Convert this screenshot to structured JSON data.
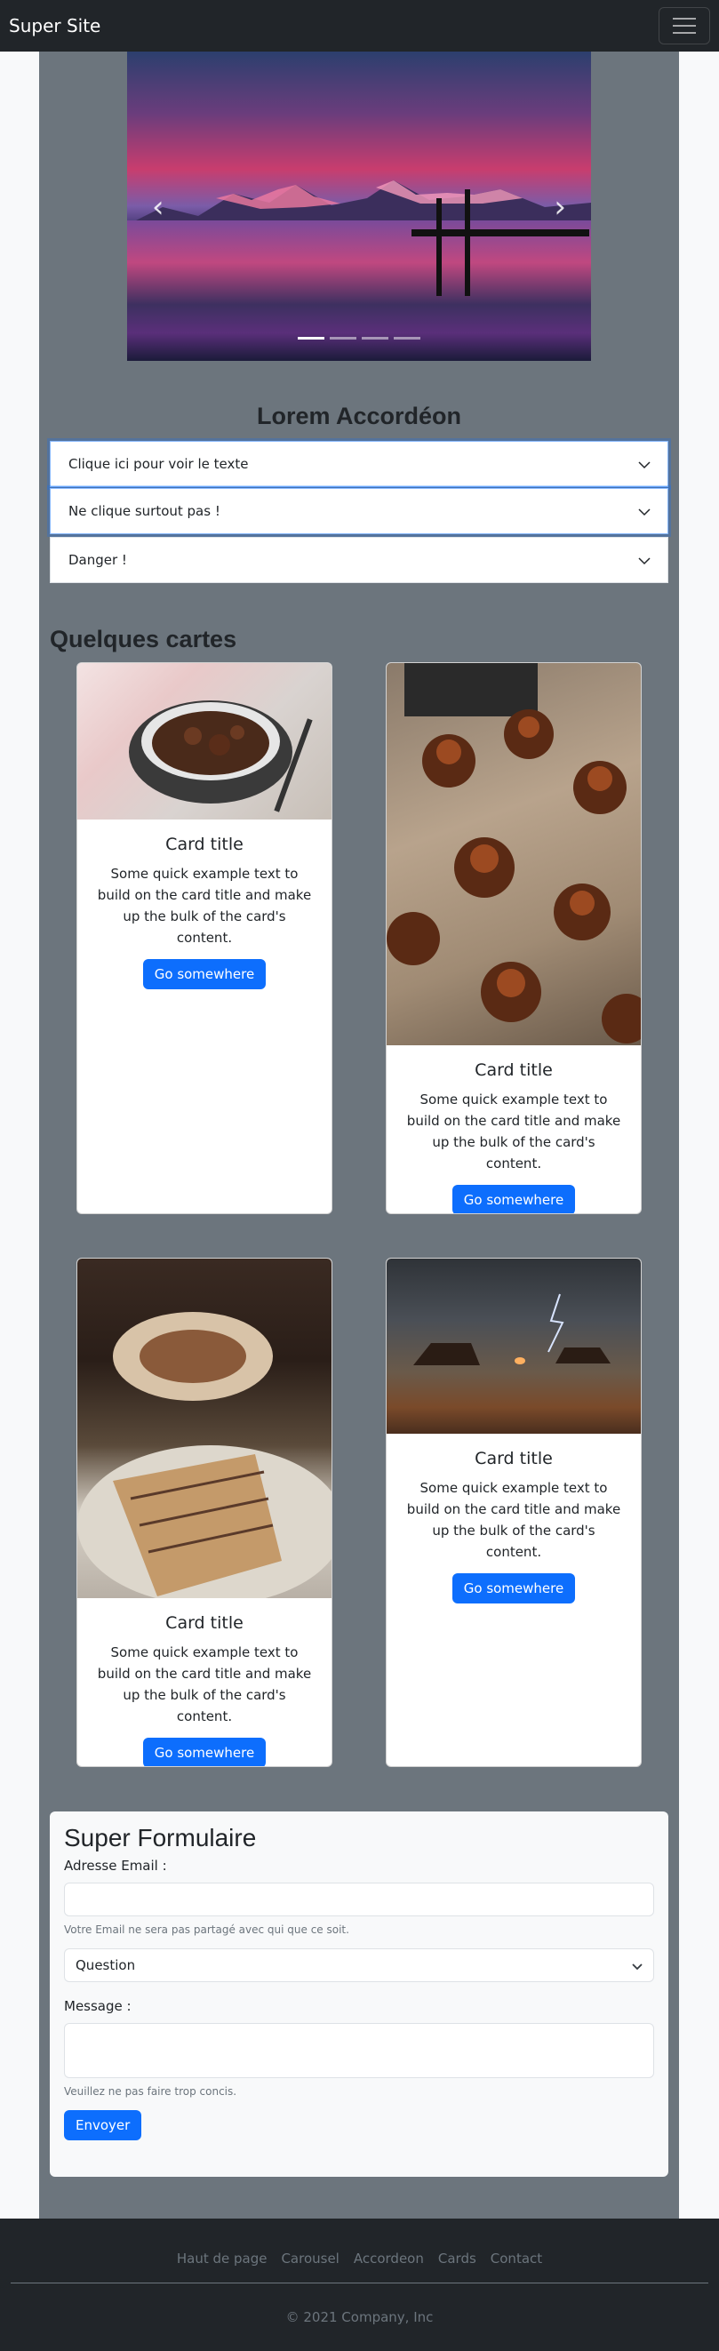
{
  "navbar": {
    "brand": "Super Site"
  },
  "carousel": {
    "slide_count": 4,
    "active_slide": 1,
    "prev_icon": "chevron-left-icon",
    "next_icon": "chevron-right-icon"
  },
  "accordion": {
    "title": "Lorem Accordéon",
    "items": [
      {
        "label": "Clique ici pour voir le texte"
      },
      {
        "label": "Ne clique surtout pas !"
      },
      {
        "label": "Danger !"
      }
    ]
  },
  "cards": {
    "title": "Quelques cartes",
    "items": [
      {
        "title": "Card title",
        "text": "Some quick example text to build on the card title and make up the bulk of the card's content.",
        "button": "Go somewhere",
        "image": "beef-stew-pot"
      },
      {
        "title": "Card title",
        "text": "Some quick example text to build on the card title and make up the bulk of the card's content.",
        "button": "Go somewhere",
        "image": "caneles-pastries"
      },
      {
        "title": "Card title",
        "text": "Some quick example text to build on the card title and make up the bulk of the card's content.",
        "button": "Go somewhere",
        "image": "okonomiyaki"
      },
      {
        "title": "Card title",
        "text": "Some quick example text to build on the card title and make up the bulk of the card's content.",
        "button": "Go somewhere",
        "image": "desert-storm-landscape"
      }
    ]
  },
  "form": {
    "title": "Super Formulaire",
    "email_label": "Adresse Email :",
    "email_help": "Votre Email ne sera pas partagé avec qui que ce soit.",
    "select_value": "Question",
    "message_label": "Message :",
    "message_help": "Veuillez ne pas faire trop concis.",
    "submit": "Envoyer"
  },
  "footer": {
    "links": [
      "Haut de page",
      "Carousel",
      "Accordeon",
      "Cards",
      "Contact"
    ],
    "copyright": "© 2021 Company, Inc"
  },
  "colors": {
    "primary": "#0d6efd",
    "dark": "#212529",
    "secondary": "#6c757d"
  }
}
